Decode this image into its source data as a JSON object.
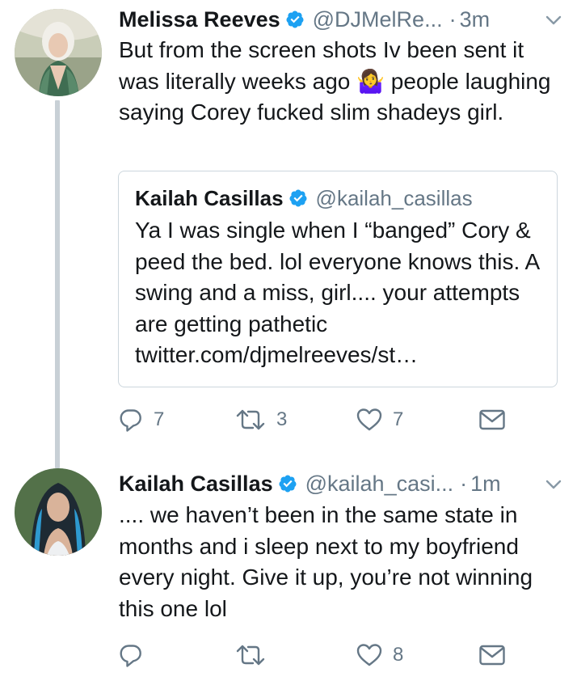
{
  "tweets": [
    {
      "author_name": "Melissa Reeves",
      "handle": "@DJMelRe...",
      "separator": "·",
      "time": "3m",
      "text": "But from the screen shots Iv been sent it was literally weeks ago 🤷‍♀️ people laughing saying Corey fucked slim shadeys girl.",
      "quoted": {
        "author_name": "Kailah Casillas",
        "handle": "@kailah_casillas",
        "text": "Ya I was single when I “banged” Cory & peed the bed. lol everyone knows this. A swing and a miss, girl.... your attempts are getting pathetic twitter.com/djmelreeves/st…"
      },
      "reply_count": "7",
      "retweet_count": "3",
      "like_count": "7"
    },
    {
      "author_name": "Kailah Casillas",
      "handle": "@kailah_casi...",
      "separator": "·",
      "time": "1m",
      "text": ".... we haven’t been in the same state in months and i sleep next to my boyfriend every night. Give it up, you’re not winning this one lol",
      "reply_count": "",
      "retweet_count": "",
      "like_count": "8"
    }
  ],
  "colors": {
    "verified": "#1da1f2",
    "secondary_text": "#657786",
    "icon": "#657786",
    "thread_line": "#c8d0d6",
    "border": "#ccd6dd"
  },
  "icons": [
    "verified-badge-icon",
    "chevron-down-icon",
    "reply-icon",
    "retweet-icon",
    "like-icon",
    "direct-message-icon"
  ]
}
